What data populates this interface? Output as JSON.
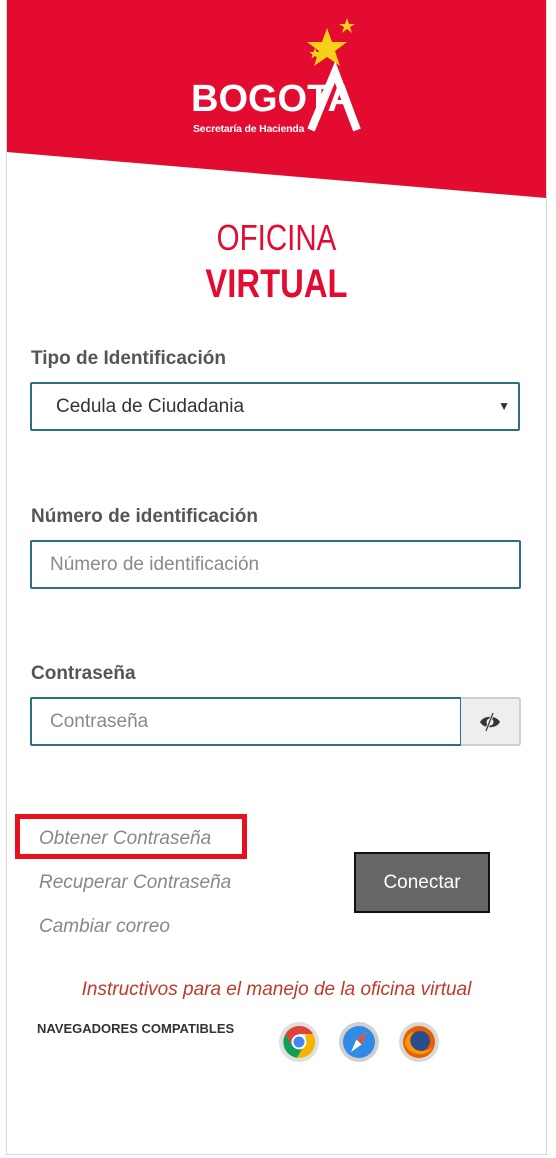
{
  "brand": {
    "name": "BOGOTA",
    "subtitle": "Secretaría de Hacienda",
    "primary_color": "#e30b2f",
    "logo_icon": "stars-logo-icon"
  },
  "heading": {
    "line1": "OFICINA",
    "line2": "VIRTUAL"
  },
  "form": {
    "tipo_label": "Tipo de Identificación",
    "tipo_selected": "Cedula de Ciudadania",
    "numero_label": "Número de identificación",
    "numero_placeholder": "Número de identificación",
    "password_label": "Contraseña",
    "password_placeholder": "Contraseña",
    "password_toggle_icon": "eye-slash-icon"
  },
  "links": {
    "obtener": "Obtener Contraseña",
    "recuperar": "Recuperar Contraseña",
    "cambiar": "Cambiar correo"
  },
  "actions": {
    "conectar": "Conectar"
  },
  "footer": {
    "instructivos": "Instructivos para el manejo de la oficina virtual",
    "navegadores": "NAVEGADORES COMPATIBLES",
    "browsers": [
      "chrome-icon",
      "safari-icon",
      "firefox-icon"
    ]
  }
}
